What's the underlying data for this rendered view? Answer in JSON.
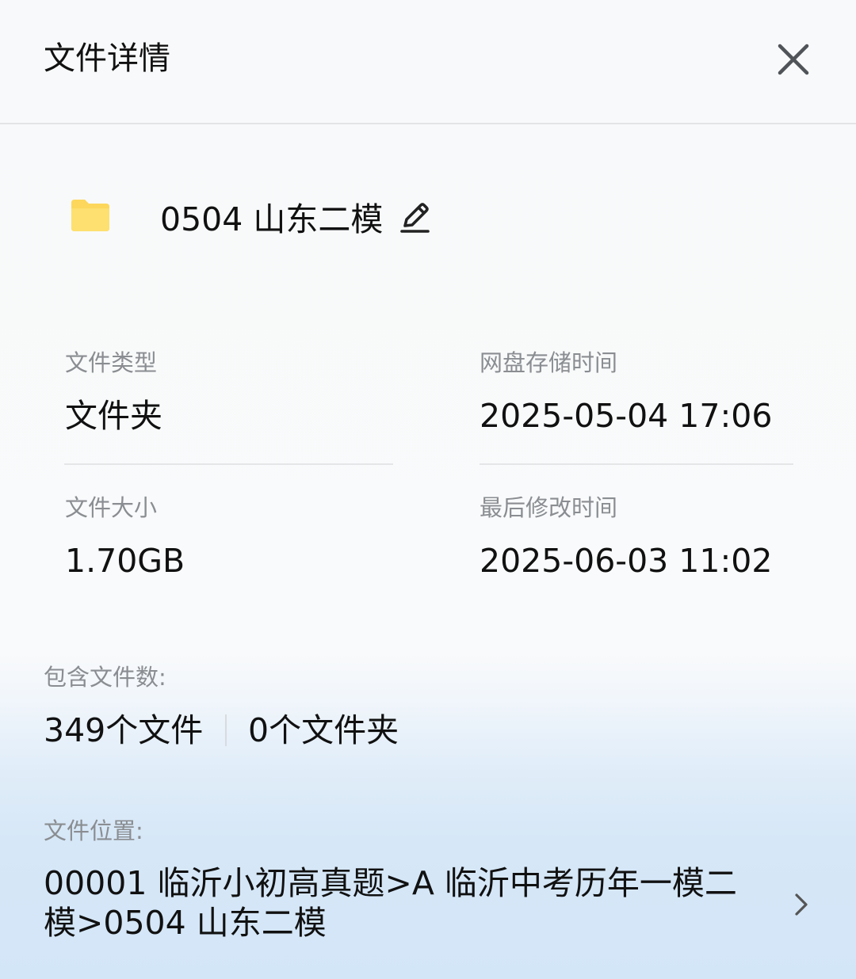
{
  "header": {
    "title": "文件详情",
    "close_icon": "close-icon"
  },
  "file": {
    "icon": "folder-icon",
    "icon_color": "#fcd75b",
    "name": "0504 山东二模",
    "edit_icon": "pencil-icon"
  },
  "details": {
    "type_label": "文件类型",
    "type_value": "文件夹",
    "stored_label": "网盘存储时间",
    "stored_value": "2025-05-04 17:06",
    "size_label": "文件大小",
    "size_value": "1.70GB",
    "modified_label": "最后修改时间",
    "modified_value": "2025-06-03 11:02"
  },
  "contents": {
    "label": "包含文件数:",
    "files": "349个文件",
    "folders": "0个文件夹"
  },
  "location": {
    "label": "文件位置:",
    "path": "00001 临沂小初高真题>A 临沂中考历年一模二模>0504 山东二模",
    "chevron_icon": "chevron-right-icon"
  }
}
